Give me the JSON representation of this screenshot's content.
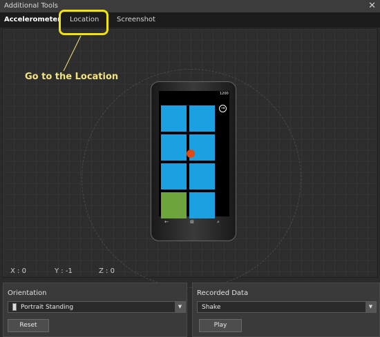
{
  "window": {
    "title": "Additional Tools",
    "close_glyph": "✕"
  },
  "tabs": [
    {
      "label": "Accelerometer",
      "active": true
    },
    {
      "label": "Location",
      "active": false
    },
    {
      "label": "Screenshot",
      "active": false
    }
  ],
  "annotation": {
    "text": "Go to the Location",
    "color": "#f2e40b"
  },
  "phone": {
    "clock": "1200",
    "tile_color": "#1ba1e2",
    "last_tile_color": "#6da53c",
    "indicator_color": "#e04a16",
    "icons": [
      "arrow-right-icon",
      "back-icon",
      "windows-start-icon",
      "search-icon"
    ],
    "nav_glyphs": {
      "back": "←",
      "start": "⊞",
      "search": "⌕"
    },
    "arrow_glyph": "→"
  },
  "coords": {
    "x": "X : 0",
    "y": "Y : -1",
    "z": "Z : 0"
  },
  "orientation": {
    "label": "Orientation",
    "selected": "Portrait Standing",
    "reset_label": "Reset"
  },
  "recorded": {
    "label": "Recorded Data",
    "selected": "Shake",
    "play_label": "Play"
  }
}
